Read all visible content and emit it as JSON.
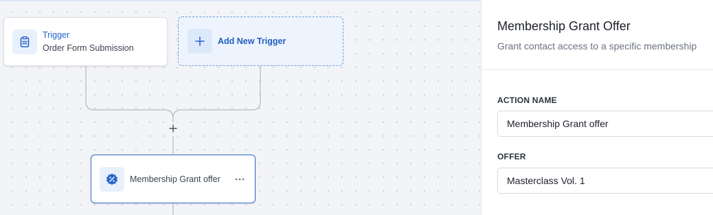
{
  "canvas": {
    "trigger": {
      "title": "Trigger",
      "subtitle": "Order Form Submission",
      "icon": "clipboard-icon"
    },
    "add_trigger": {
      "label": "Add New Trigger",
      "icon": "plus-icon"
    },
    "add_step_icon": "plus-icon",
    "action": {
      "label": "Membership Grant offer",
      "icon": "percent-badge-icon",
      "more_icon": "more-horizontal-icon"
    }
  },
  "panel": {
    "title": "Membership Grant Offer",
    "subtitle": "Grant contact access to a specific membership",
    "fields": [
      {
        "label": "ACTION NAME",
        "value": "Membership Grant offer"
      },
      {
        "label": "OFFER",
        "value": "Masterclass Vol. 1"
      }
    ]
  },
  "colors": {
    "accent": "#2563c9",
    "canvas_bg": "#f3f4f8",
    "node_border_selected": "#2f6cc4",
    "add_trigger_bg": "#eef4fd"
  }
}
